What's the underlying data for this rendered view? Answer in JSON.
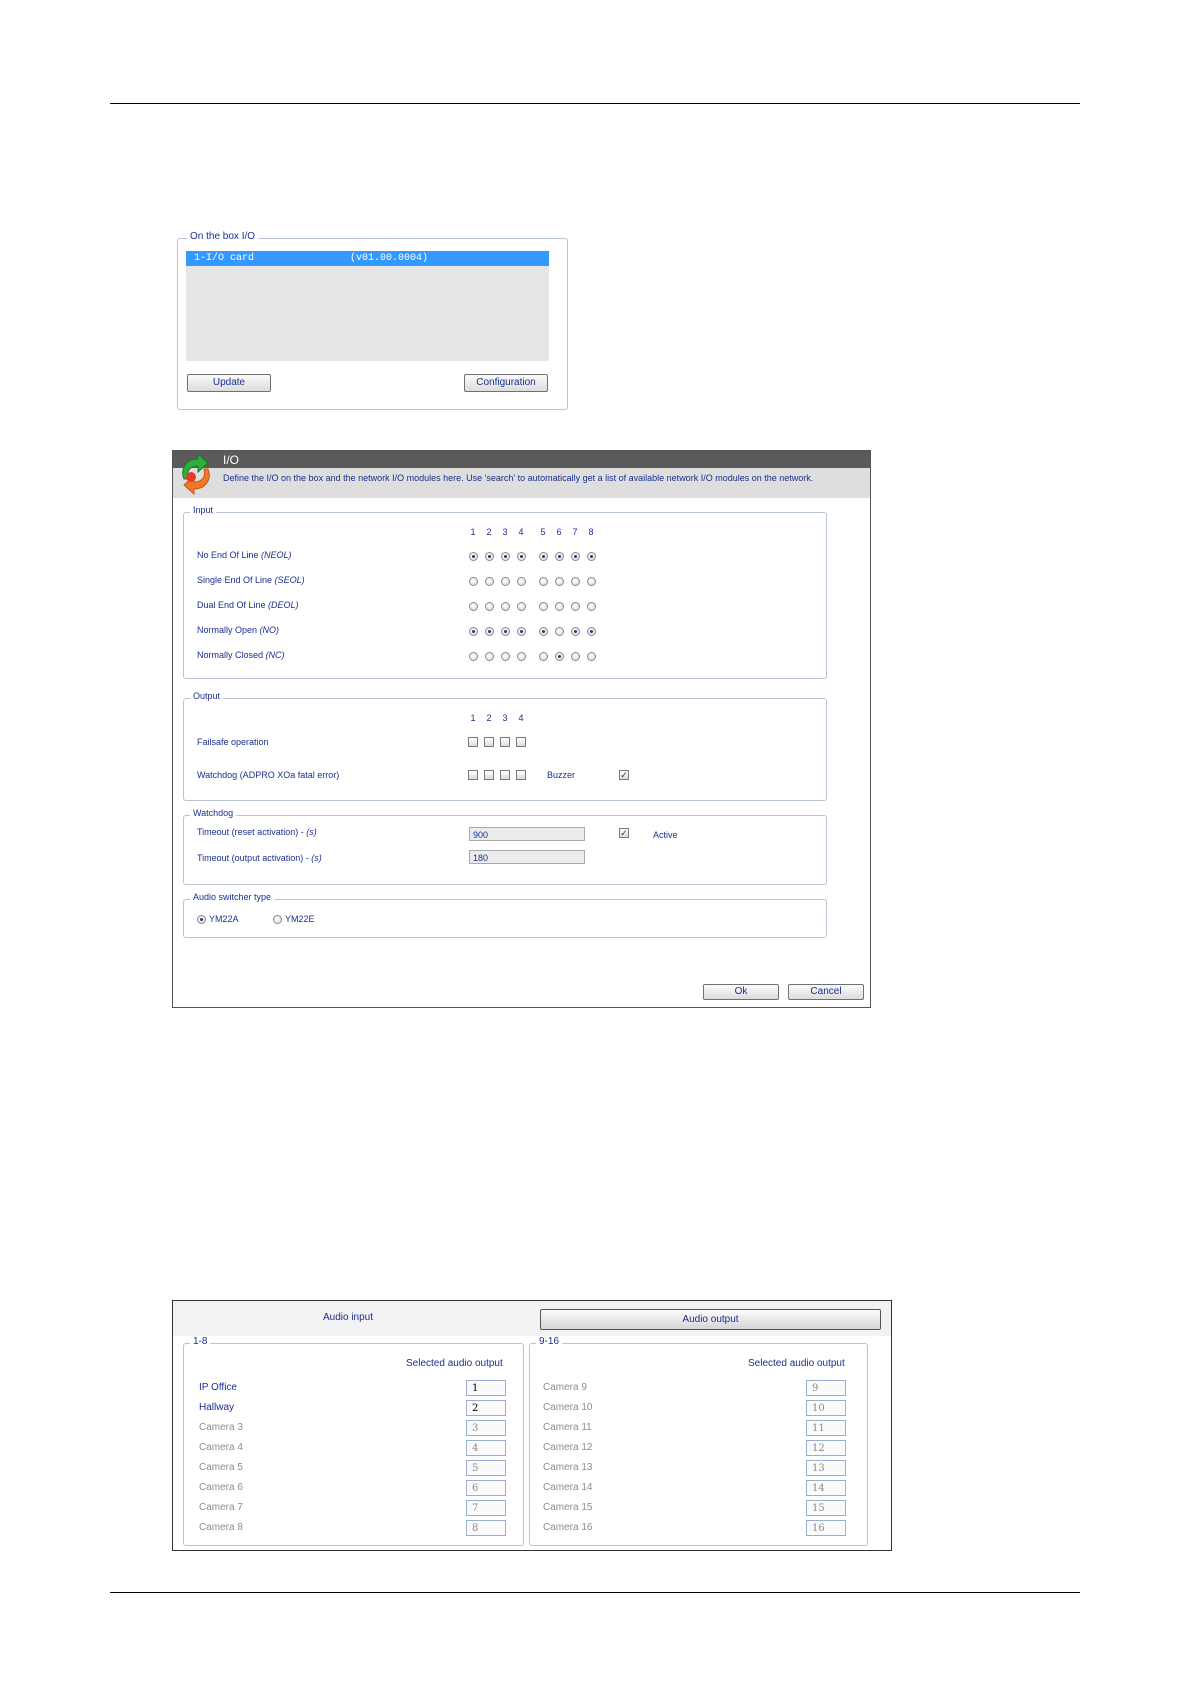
{
  "onbox": {
    "legend": "On the box I/O",
    "item_name": "1-I/O card",
    "item_version": "(v01.00.0004)",
    "update_label": "Update",
    "config_label": "Configuration"
  },
  "dialog": {
    "title": "I/O",
    "description": "Define the I/O on the box and the network I/O modules here. Use 'search' to automatically get a list of available network I/O modules on the network.",
    "input": {
      "legend": "Input",
      "columns": [
        "1",
        "2",
        "3",
        "4",
        "5",
        "6",
        "7",
        "8"
      ],
      "rows": [
        {
          "label": "No End Of Line ",
          "abbr": "(NEOL)"
        },
        {
          "label": "Single End Of Line ",
          "abbr": "(SEOL)"
        },
        {
          "label": "Dual End Of Line ",
          "abbr": "(DEOL)"
        },
        {
          "label": "Normally Open ",
          "abbr": "(NO)"
        },
        {
          "label": "Normally Closed ",
          "abbr": "(NC)"
        }
      ]
    },
    "output": {
      "legend": "Output",
      "columns": [
        "1",
        "2",
        "3",
        "4"
      ],
      "failsafe_label": "Failsafe operation",
      "watchdog_label": "Watchdog (ADPRO XOa fatal error)",
      "buzzer_label": "Buzzer"
    },
    "watchdog": {
      "legend": "Watchdog",
      "reset_label": "Timeout (reset activation) - ",
      "reset_unit": "(s)",
      "reset_value": "900",
      "output_label": "Timeout (output activation) - ",
      "output_unit": "(s)",
      "output_value": "180",
      "active_label": "Active"
    },
    "audio_switcher": {
      "legend": "Audio switcher type",
      "option_a": "YM22A",
      "option_b": "YM22E"
    },
    "ok_label": "Ok",
    "cancel_label": "Cancel"
  },
  "audio": {
    "tab_input": "Audio input",
    "tab_output": "Audio output",
    "left": {
      "legend": "1-8",
      "header": "Selected audio output",
      "items": [
        {
          "name": "IP Office",
          "value": "1"
        },
        {
          "name": "Hallway",
          "value": "2"
        },
        {
          "name": "Camera 3",
          "value": "3"
        },
        {
          "name": "Camera 4",
          "value": "4"
        },
        {
          "name": "Camera 5",
          "value": "5"
        },
        {
          "name": "Camera 6",
          "value": "6"
        },
        {
          "name": "Camera 7",
          "value": "7"
        },
        {
          "name": "Camera 8",
          "value": "8"
        }
      ]
    },
    "right": {
      "legend": "9-16",
      "header": "Selected audio output",
      "items": [
        {
          "name": "Camera 9",
          "value": "9"
        },
        {
          "name": "Camera 10",
          "value": "10"
        },
        {
          "name": "Camera 11",
          "value": "11"
        },
        {
          "name": "Camera 12",
          "value": "12"
        },
        {
          "name": "Camera 13",
          "value": "13"
        },
        {
          "name": "Camera 14",
          "value": "14"
        },
        {
          "name": "Camera 15",
          "value": "15"
        },
        {
          "name": "Camera 16",
          "value": "16"
        }
      ]
    }
  }
}
